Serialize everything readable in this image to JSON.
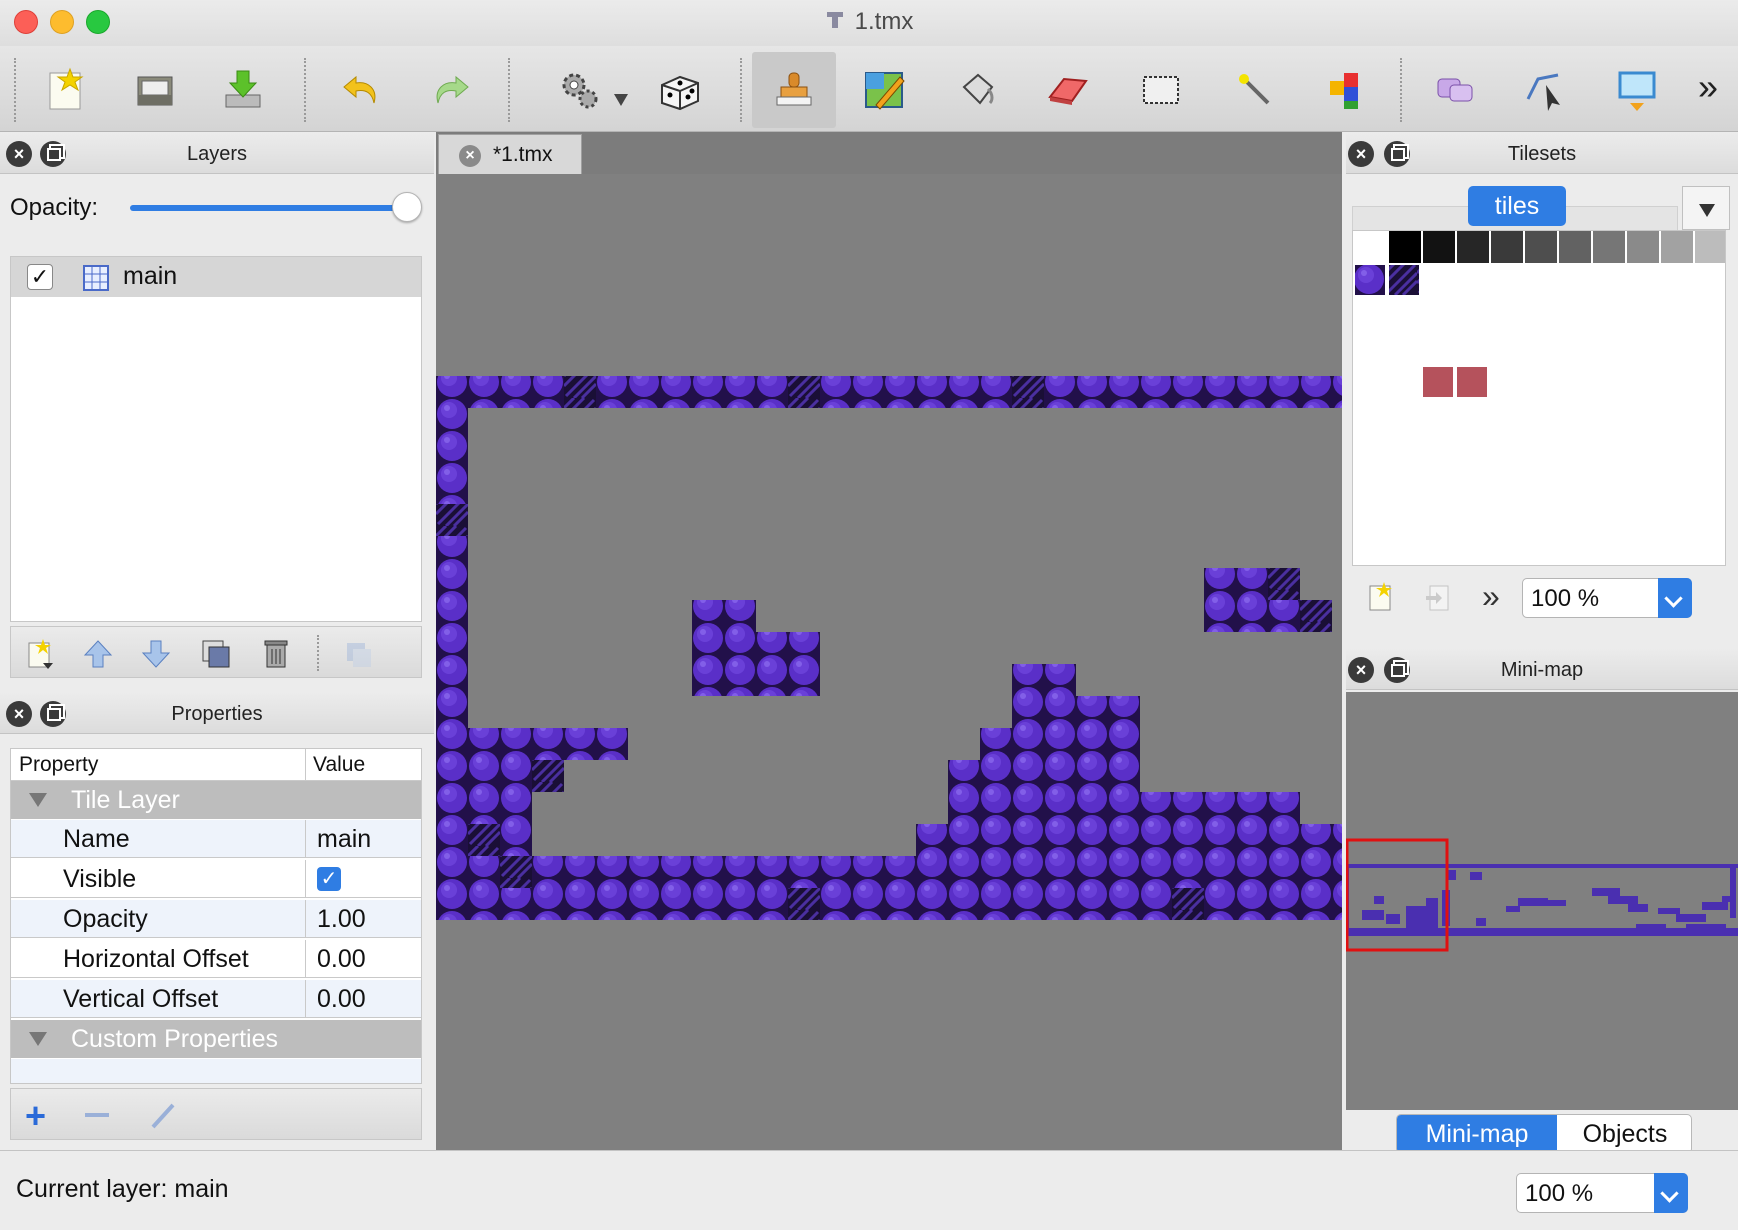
{
  "window": {
    "title": "1.tmx"
  },
  "toolbar": {
    "items": [
      {
        "name": "new-map"
      },
      {
        "name": "open"
      },
      {
        "name": "save"
      },
      {
        "name": "undo"
      },
      {
        "name": "redo"
      },
      {
        "name": "commands"
      },
      {
        "name": "random-mode"
      },
      {
        "name": "stamp-brush"
      },
      {
        "name": "terrain-brush"
      },
      {
        "name": "bucket-fill"
      },
      {
        "name": "eraser"
      },
      {
        "name": "rectangular-select"
      },
      {
        "name": "magic-wand"
      },
      {
        "name": "select-same-tile"
      },
      {
        "name": "select-objects"
      },
      {
        "name": "edit-polygons"
      },
      {
        "name": "insert-rectangle"
      }
    ],
    "more": "»"
  },
  "layers": {
    "title": "Layers",
    "opacity_label": "Opacity:",
    "opacity_value": 1.0,
    "items": [
      {
        "name": "main",
        "visible": true,
        "type": "tile-layer"
      }
    ]
  },
  "properties": {
    "title": "Properties",
    "col_property": "Property",
    "col_value": "Value",
    "group_tile_layer": "Tile Layer",
    "rows": [
      {
        "key": "Name",
        "value": "main"
      },
      {
        "key": "Visible",
        "value": ""
      },
      {
        "key": "Opacity",
        "value": "1.00"
      },
      {
        "key": "Horizontal Offset",
        "value": "0.00"
      },
      {
        "key": "Vertical Offset",
        "value": "0.00"
      }
    ],
    "group_custom": "Custom Properties"
  },
  "document": {
    "tab_label": "*1.tmx"
  },
  "tilesets": {
    "title": "Tilesets",
    "tab_label": "tiles",
    "zoom": "100 %"
  },
  "minimap": {
    "title": "Mini-map",
    "tab_minimap": "Mini-map",
    "tab_objects": "Objects"
  },
  "status": {
    "current_layer": "Current layer: main",
    "zoom": "100 %"
  },
  "colors": {
    "tile_purple": "#5a2fc8",
    "map_background": "#808080",
    "accent": "#2f7de3",
    "viewport_frame": "#e01010"
  }
}
